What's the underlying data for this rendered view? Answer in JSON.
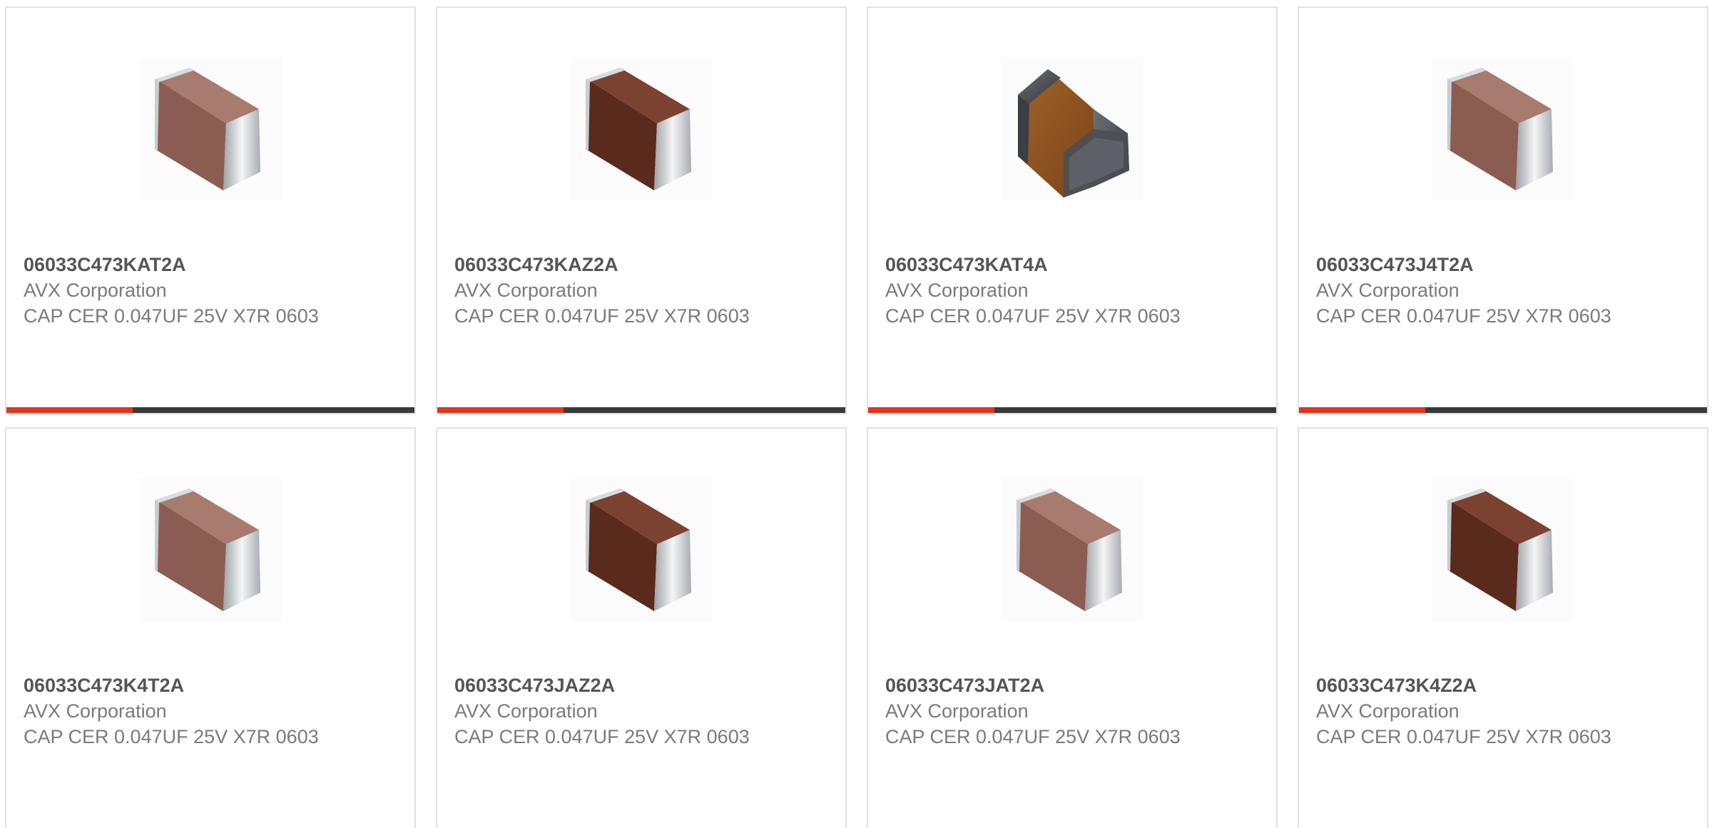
{
  "colors": {
    "accent": "#e0361c",
    "bar_track": "#3a3a3a",
    "part_text": "#555555",
    "body_text": "#7a7a7a",
    "card_border": "#e2e2e2"
  },
  "products": [
    {
      "part": "06033C473KAT2A",
      "manufacturer": "AVX Corporation",
      "description": "CAP CER 0.047UF 25V X7R 0603",
      "image": "capacitor-light-icon",
      "bar_progress": 0.31
    },
    {
      "part": "06033C473KAZ2A",
      "manufacturer": "AVX Corporation",
      "description": "CAP CER 0.047UF 25V X7R 0603",
      "image": "capacitor-dark-icon",
      "bar_progress": 0.31
    },
    {
      "part": "06033C473KAT4A",
      "manufacturer": "AVX Corporation",
      "description": "CAP CER 0.047UF 25V X7R 0603",
      "image": "capacitor-orange-icon",
      "bar_progress": 0.31
    },
    {
      "part": "06033C473J4T2A",
      "manufacturer": "AVX Corporation",
      "description": "CAP CER 0.047UF 25V X7R 0603",
      "image": "capacitor-light-icon",
      "bar_progress": 0.31
    },
    {
      "part": "06033C473K4T2A",
      "manufacturer": "AVX Corporation",
      "description": "CAP CER 0.047UF 25V X7R 0603",
      "image": "capacitor-light-icon"
    },
    {
      "part": "06033C473JAZ2A",
      "manufacturer": "AVX Corporation",
      "description": "CAP CER 0.047UF 25V X7R 0603",
      "image": "capacitor-dark-icon"
    },
    {
      "part": "06033C473JAT2A",
      "manufacturer": "AVX Corporation",
      "description": "CAP CER 0.047UF 25V X7R 0603",
      "image": "capacitor-light-icon"
    },
    {
      "part": "06033C473K4Z2A",
      "manufacturer": "AVX Corporation",
      "description": "CAP CER 0.047UF 25V X7R 0603",
      "image": "capacitor-dark-icon"
    }
  ]
}
